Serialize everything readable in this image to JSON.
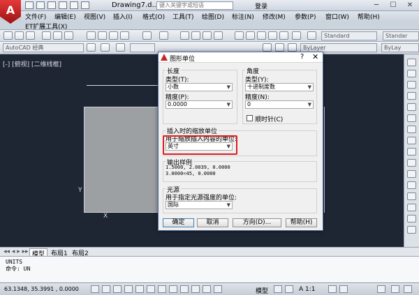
{
  "window": {
    "app_logo": "A",
    "doc_title": "Drawing7.d...",
    "search_placeholder": "键入关键字或短语",
    "login": "登录",
    "minimize": "─",
    "restore": "☐",
    "close": "✕"
  },
  "menu": {
    "items": [
      "文件(F)",
      "编辑(E)",
      "视图(V)",
      "插入(I)",
      "格式(O)",
      "工具(T)",
      "绘图(D)",
      "标注(N)",
      "修改(M)",
      "参数(P)",
      "窗口(W)",
      "帮助(H)"
    ],
    "et": "ET扩展工具(X)"
  },
  "toolbar": {
    "style1": "Standard",
    "style2": "Standar"
  },
  "toolbar2": {
    "workspace": "AutoCAD 经典",
    "layer": "ByLayer",
    "layer2": "ByLay"
  },
  "canvas": {
    "viewport_label": "[-] [俯视] [二维线框]",
    "ucs_y": "Y",
    "ucs_x": "X"
  },
  "dialog": {
    "title": "图形单位",
    "help_icon": "?",
    "close_icon": "✕",
    "length": {
      "label": "长度",
      "type_label": "类型(T):",
      "type_value": "小数",
      "precision_label": "精度(P):",
      "precision_value": "0.0000"
    },
    "angle": {
      "label": "角度",
      "type_label": "类型(Y):",
      "type_value": "十进制度数",
      "precision_label": "精度(N):",
      "precision_value": "0",
      "clockwise_label": "顺时针(C)"
    },
    "insert_scale": {
      "label": "插入时的缩放单位",
      "desc": "用于缩放插入内容的单位:",
      "value": "英寸"
    },
    "sample": {
      "label": "输出样例",
      "line1": "1.5000, 2.0039, 0.0000",
      "line2": "3.0000<45, 0.0000"
    },
    "light": {
      "label": "光源",
      "desc": "用于指定光源强度的单位:",
      "value": "国际"
    },
    "buttons": {
      "ok": "确定",
      "cancel": "取消",
      "direction": "方向(D)...",
      "help": "帮助(H)"
    }
  },
  "tabs": {
    "model": "模型",
    "layout1": "布局1",
    "layout2": "布局2"
  },
  "command": {
    "line1": "UNITS",
    "line2": "命令: UN"
  },
  "status": {
    "coords": "63.1348,  35.3991 , 0.0000",
    "model": "模型",
    "scale": "A 1:1"
  }
}
